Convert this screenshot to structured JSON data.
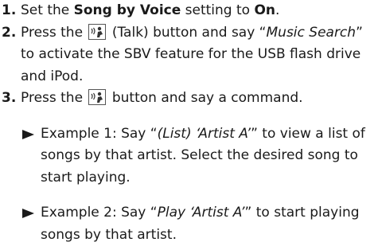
{
  "steps": [
    {
      "number": "1.",
      "parts": {
        "a": "Set the ",
        "b": "Song by Voice",
        "c": " setting to ",
        "d": "On",
        "e": "."
      }
    },
    {
      "number": "2.",
      "parts": {
        "a": "Press the ",
        "b": " (Talk) button and say “",
        "c": "Music Search",
        "d": "” to activate the SBV feature for the USB flash drive and iPod."
      },
      "icon": "talk-icon"
    },
    {
      "number": "3.",
      "parts": {
        "a": "Press the ",
        "b": " button and say a command."
      },
      "icon": "talk-icon",
      "examples": [
        {
          "a": "Example 1: Say “",
          "b": "(List) ‘Artist A’",
          "c": "” to view a list of songs by that artist. Select the desired song to start playing."
        },
        {
          "a": "Example 2: Say “",
          "b": "Play ‘Artist A’",
          "c": "” to start playing songs by that artist."
        }
      ]
    }
  ]
}
